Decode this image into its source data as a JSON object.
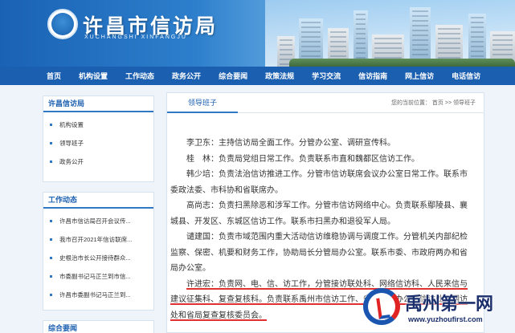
{
  "header": {
    "site_title": "许昌市信访局",
    "site_subtitle": "XUCHANGSHI XINFANGJU"
  },
  "nav": {
    "items": [
      "首页",
      "机构设置",
      "工作动态",
      "政务公开",
      "综合要闻",
      "政策法规",
      "学习交流",
      "信访指南",
      "网上信访",
      "电话信访"
    ]
  },
  "sidebar": {
    "bureau": {
      "title": "许昌信访局",
      "items": [
        "机构设置",
        "领导班子",
        "政务公开"
      ]
    },
    "news": {
      "title": "工作动态",
      "items": [
        "许昌市信访局召开会议传...",
        "我市召开2021年信访联席...",
        "史根治市长公开接待群众...",
        "市委副书记马正兰到市信...",
        "许昌市委副书记马正兰到..."
      ]
    },
    "more": {
      "title": "综合要闻"
    }
  },
  "main": {
    "tab": "领导班子",
    "breadcrumb": "您的当前位置： 首页 >> 领导班子",
    "paragraphs": [
      "李卫东：主持信访局全面工作。分管办公室、调研宣传科。",
      "桂　林：负责局党组日常工作。负责联系市直和魏都区信访工作。",
      "韩少培：负责法治信访推进工作。分管市信访联席会议办公室日常工作。联系市委政法委、市科协和省联席办。",
      "高尚志：负责扫黑除恶和涉军工作。分管市信访网络中心。负责联系鄢陵县、襄城县、开发区、东城区信访工作。联系市扫黑办和退役军人局。",
      "谴建国：负责市域范围内重大活动信访维稳协调与调度工作。分管机关内部纪检监察、保密、机要和财务工作，协助局长分管局办公室。联系市委、市政府两办和省局办公室。"
    ],
    "highlight": {
      "before": "许进宏：",
      "underlined": "负责网、电、信、访工作，分管接访联处科、网络信访科、人民来信与建议征集科、复查复核科。负责联系禹州市信访工作、省信访局办公室信访处、网访处和省局复查复核委员会。"
    }
  },
  "watermark": {
    "name": "禹州第一网",
    "url": "www.yuzhoufirst.com"
  }
}
